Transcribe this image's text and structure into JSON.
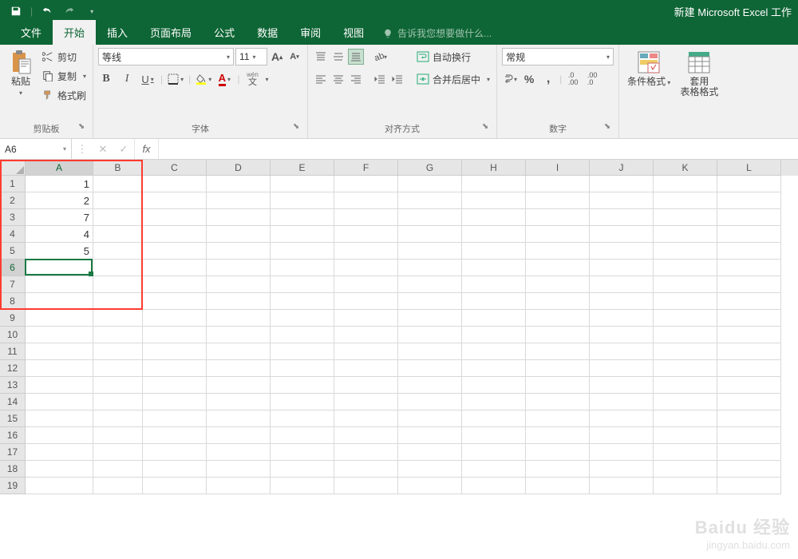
{
  "title": "新建 Microsoft Excel 工作",
  "tabs": {
    "file": "文件",
    "home": "开始",
    "insert": "插入",
    "layout": "页面布局",
    "formulas": "公式",
    "data": "数据",
    "review": "审阅",
    "view": "视图"
  },
  "tellme": "告诉我您想要做什么...",
  "clipboard": {
    "paste": "粘贴",
    "cut": "剪切",
    "copy": "复制",
    "painter": "格式刷",
    "group": "剪贴板"
  },
  "font": {
    "name": "等线",
    "size": "11",
    "group": "字体",
    "bold": "B",
    "italic": "I",
    "underline": "U",
    "wen": "wén",
    "wen2": "文"
  },
  "align": {
    "wrap": "自动换行",
    "merge": "合并后居中",
    "group": "对齐方式"
  },
  "number": {
    "format": "常规",
    "percent": "%",
    "comma": ",",
    "group": "数字"
  },
  "styles": {
    "condfmt": "条件格式",
    "tablefmt": "套用\n表格格式",
    "group": ""
  },
  "namebox": "A6",
  "columns": [
    "A",
    "B",
    "C",
    "D",
    "E",
    "F",
    "G",
    "H",
    "I",
    "J",
    "K",
    "L"
  ],
  "rows": [
    "1",
    "2",
    "3",
    "4",
    "5",
    "6",
    "7",
    "8",
    "9",
    "10",
    "11",
    "12",
    "13",
    "14",
    "15",
    "16",
    "17",
    "18",
    "19"
  ],
  "values": {
    "A1": "1",
    "A2": "2",
    "A3": "7",
    "A4": "4",
    "A5": "5"
  },
  "colwidths": {
    "default": 80,
    "A": 85,
    "B": 62
  },
  "selected": {
    "col": 0,
    "row": 5
  },
  "redbox": {
    "fromRow": 0,
    "toRow": 7,
    "fromCol": 0,
    "toCol": 1
  },
  "watermark": {
    "brand": "Baidu 经验",
    "url": "jingyan.baidu.com"
  }
}
